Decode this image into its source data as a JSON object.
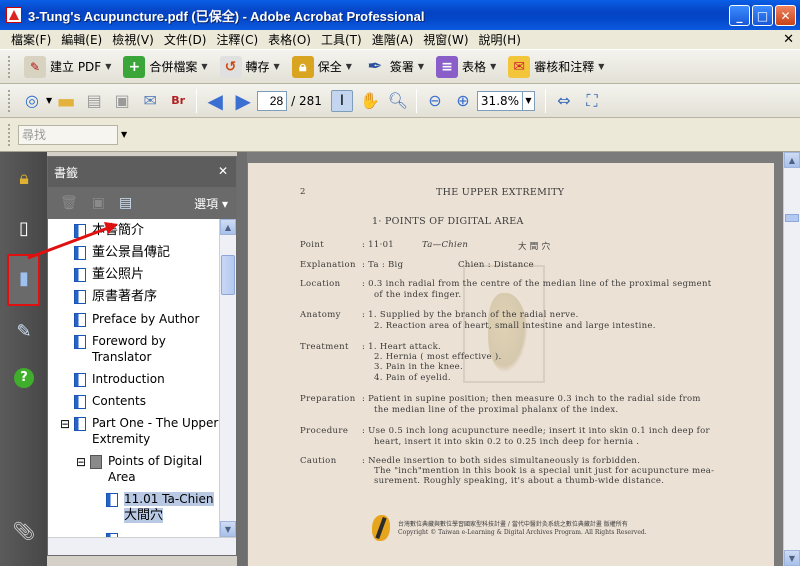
{
  "window": {
    "title": "3-Tung's Acupuncture.pdf (已保全) - Adobe Acrobat Professional"
  },
  "menu": [
    "檔案(F)",
    "編輯(E)",
    "檢視(V)",
    "文件(D)",
    "注釋(C)",
    "表格(O)",
    "工具(T)",
    "進階(A)",
    "視窗(W)",
    "說明(H)"
  ],
  "toolbar1": {
    "create_pdf": "建立 PDF",
    "combine": "合併檔案",
    "export": "轉存",
    "secure": "保全",
    "sign": "簽署",
    "forms": "表格",
    "review": "審核和注釋"
  },
  "toolbar2": {
    "page_current": "28",
    "page_total": "/ 281",
    "zoom": "31.8%"
  },
  "toolbar3": {
    "search_placeholder": "尋找"
  },
  "bookmarks": {
    "title": "書籤",
    "options": "選項",
    "items": [
      "本書簡介",
      "董公景昌傳記",
      "董公照片",
      "原書著者序",
      "Preface by Author",
      "Foreword by",
      "Translator",
      "Introduction",
      "Contents",
      "Part One - The Upper",
      "Extremity",
      "Points of Digital",
      "Area",
      "11.01 Ta-Chien",
      "大間穴"
    ]
  },
  "page": {
    "page_no": "2",
    "header": "THE  UPPER  EXTREMITY",
    "section": "1· POINTS  OF  DIGITAL  AREA",
    "point_label": "Point",
    "point_value": ":  11·01",
    "point_name": "Ta—Chien",
    "point_cn": "大   間   穴",
    "explanation_label": "Explanation",
    "explanation_value": ":  Ta : Big",
    "explanation_value2": "Chien : Distance",
    "location_label": "Location",
    "location_1": ":  0.3 inch radial from the centre of the median line of the proximal segment",
    "location_2": "of the index finger.",
    "anatomy_label": "Anatomy",
    "anatomy_1": ":  1. Supplied by the branch of the radial nerve.",
    "anatomy_2": "2. Reaction area of heart, small intestine and large intestine.",
    "treatment_label": "Treatment",
    "treatment_1": ":  1. Heart attack.",
    "treatment_2": "2. Hernia ( most effective ).",
    "treatment_3": "3. Pain in the knee.",
    "treatment_4": "4. Pain of eyelid.",
    "preparation_label": "Preparation",
    "preparation_1": ":  Patient in supine position;  then measure 0.3 inch to the radial side from",
    "preparation_2": "the median line of the proximal phalanx of the index.",
    "procedure_label": "Procedure",
    "procedure_1": ":  Use 0.5 inch long acupuncture needle;  insert it into skin 0.1 inch deep for",
    "procedure_2": "heart, insert it into skin 0.2 to 0.25 inch deep for hernia .",
    "caution_label": "Caution",
    "caution_1": ":  Needle insertion to both sides simultaneously is forbidden.",
    "caution_2": "The \"inch\"mention in this book is a special unit just for acupuncture mea-",
    "caution_3": "surement. Roughly  speaking,  it's about a thumb-wide distance.",
    "footer_cn": "台灣數位典藏與數位學習國家型科技計畫 / 當代中醫針灸系統之數位典藏計畫 版權所有",
    "footer_en": "Copyright © Taiwan e-Learning & Digital Archives Program. All Rights Reserved."
  }
}
